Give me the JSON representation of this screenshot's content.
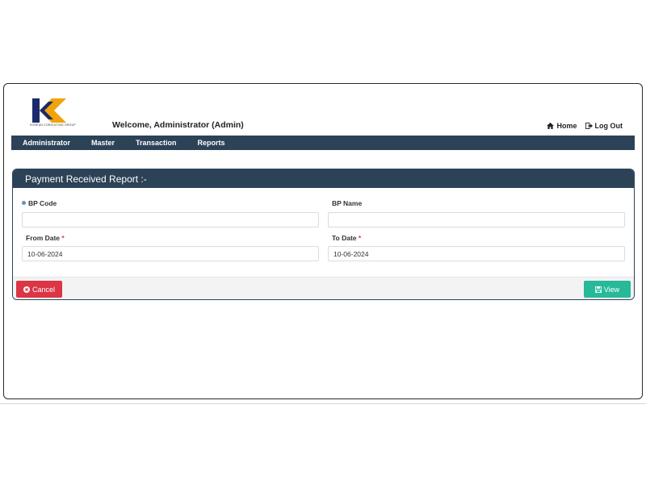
{
  "header": {
    "logo_caption": "KOREAN CONSULTING GROUP",
    "welcome_text": "Welcome,  Administrator (Admin)",
    "home_label": "Home",
    "logout_label": "Log Out"
  },
  "nav": {
    "items": [
      "Administrator",
      "Master",
      "Transaction",
      "Reports"
    ]
  },
  "panel": {
    "title": "Payment Received Report :-",
    "bp_code_label": "BP Code",
    "bp_code_value": "",
    "bp_name_label": "BP Name",
    "bp_name_value": "",
    "from_date_label": "From Date",
    "from_date_value": "10-06-2024",
    "to_date_label": "To Date",
    "to_date_value": "10-06-2024",
    "required_mark": "*"
  },
  "buttons": {
    "cancel_label": "Cancel",
    "view_label": "View"
  },
  "colors": {
    "navbar": "#2c4257",
    "cancel": "#dc3545",
    "view": "#26b99a",
    "logo_navy": "#1a2a6c",
    "logo_orange": "#f0a30a"
  }
}
